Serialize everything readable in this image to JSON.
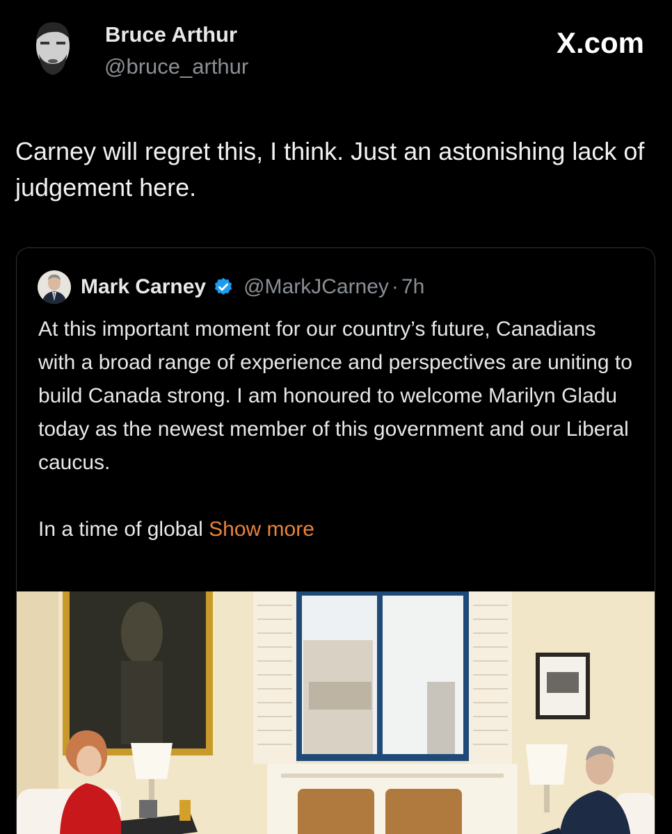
{
  "brand": {
    "label": "X.com"
  },
  "post": {
    "author": {
      "name": "Bruce Arthur",
      "handle": "@bruce_arthur"
    },
    "text": "Carney will regret this, I think. Just an astonishing lack of judgement here."
  },
  "quoted_post": {
    "author": {
      "name": "Mark Carney",
      "handle": "@MarkJCarney",
      "separator": "·",
      "time": "7h",
      "verified_icon": "verified-badge-icon"
    },
    "body": "At this important moment for our country’s future, Canadians with a broad range of experience and perspectives are uniting to build Canada strong. I am honoured to welcome Marilyn Gladu today as the newest member of this government and our Liberal caucus.",
    "body_more": "In a time of global ",
    "show_more_label": "Show more"
  },
  "colors": {
    "background": "#000000",
    "text": "#e7e9ea",
    "muted": "#8b9096",
    "show_more": "#e8833a",
    "verified": "#1d9bf0",
    "border": "#2f3336"
  }
}
